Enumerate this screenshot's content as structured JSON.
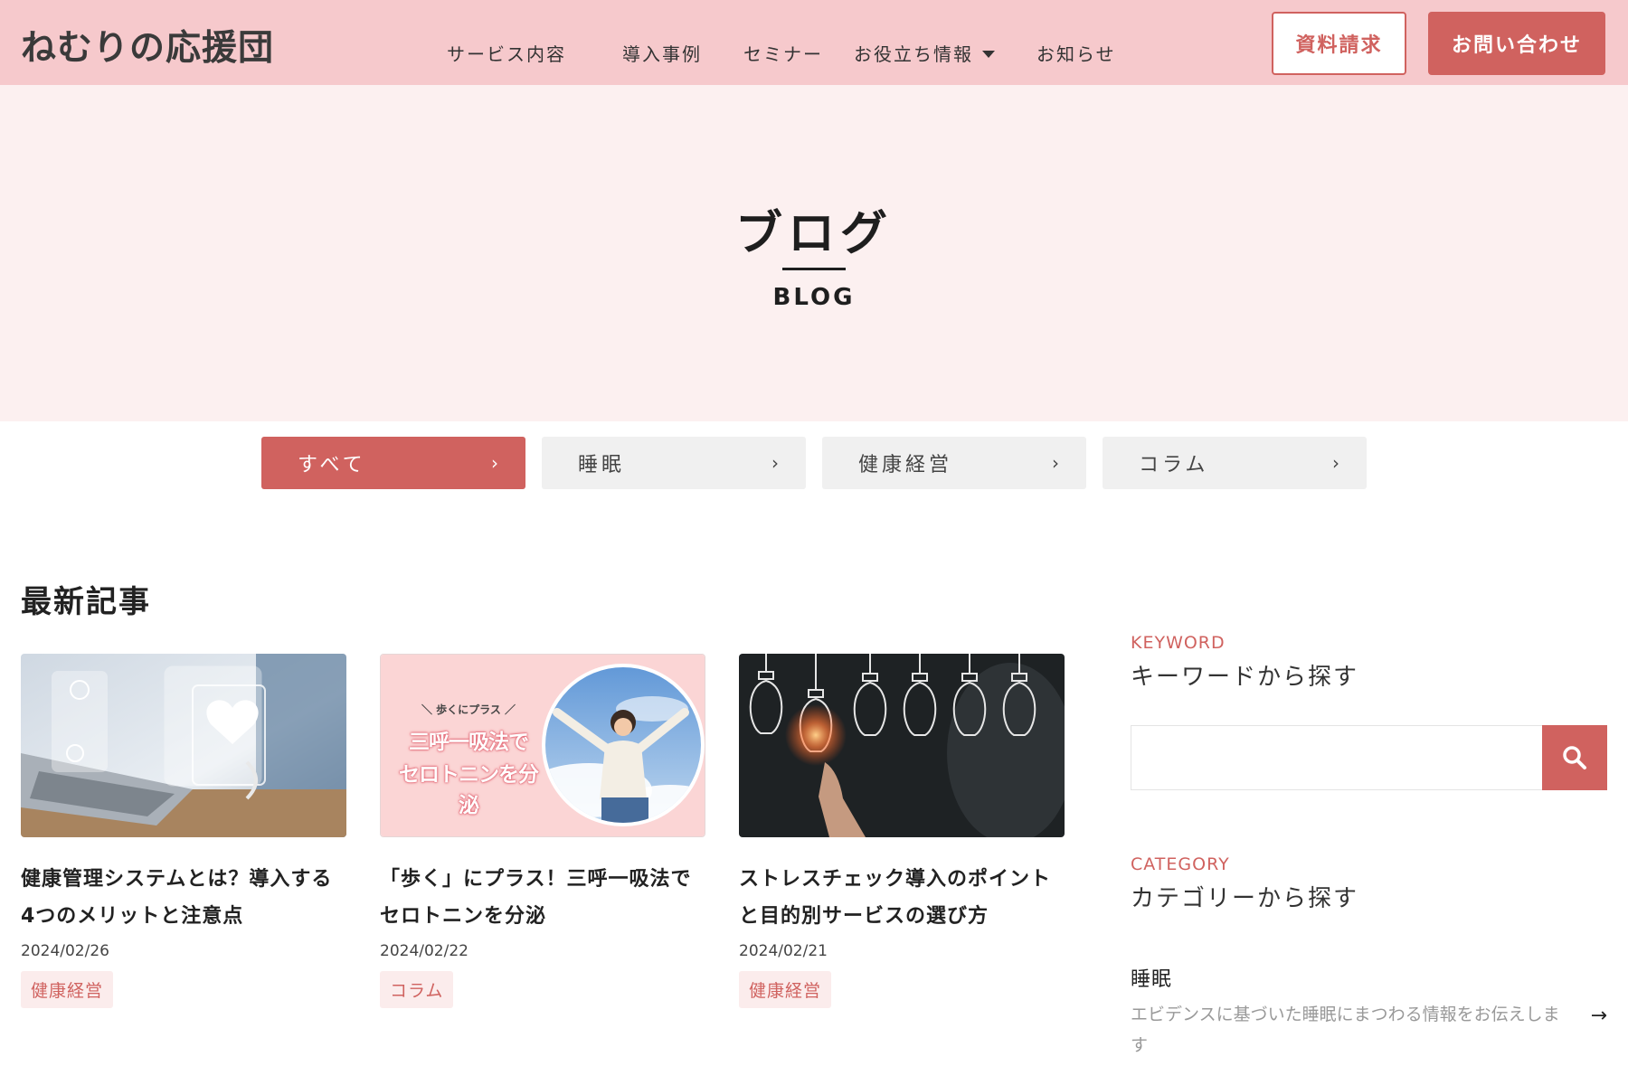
{
  "header": {
    "logo": "ねむりの応援団",
    "nav": [
      "サービス内容",
      "導入事例",
      "セミナー",
      "お役立ち情報",
      "お知らせ"
    ],
    "doc_button": "資料請求",
    "contact_button": "お問い合わせ"
  },
  "hero": {
    "title": "ブログ",
    "subtitle": "BLOG"
  },
  "tabs": [
    "すべて",
    "睡眠",
    "健康経営",
    "コラム"
  ],
  "latest": {
    "title": "最新記事",
    "posts": [
      {
        "title": "健康管理システムとは？導入する4つのメリットと注意点",
        "date": "2024/02/26",
        "tag": "健康経営"
      },
      {
        "title": "「歩く」にプラス！三呼一吸法でセロトニンを分泌",
        "date": "2024/02/22",
        "tag": "コラム",
        "thumb_small": "＼ 歩くにプラス ／",
        "thumb_line1": "三呼一吸法で",
        "thumb_line2": "セロトニンを分泌"
      },
      {
        "title": "ストレスチェック導入のポイントと目的別サービスの選び方",
        "date": "2024/02/21",
        "tag": "健康経営"
      }
    ]
  },
  "sidebar": {
    "keyword_en": "KEYWORD",
    "keyword_jp": "キーワードから探す",
    "search_placeholder": "",
    "category_en": "CATEGORY",
    "category_jp": "カテゴリーから探す",
    "category_item": {
      "name": "睡眠",
      "desc": "エビデンスに基づいた睡眠にまつわる情報をお伝えします"
    }
  },
  "colors": {
    "accent": "#d0625f",
    "header_bg": "#f6c9cc",
    "hero_bg": "#fcf0f0"
  }
}
